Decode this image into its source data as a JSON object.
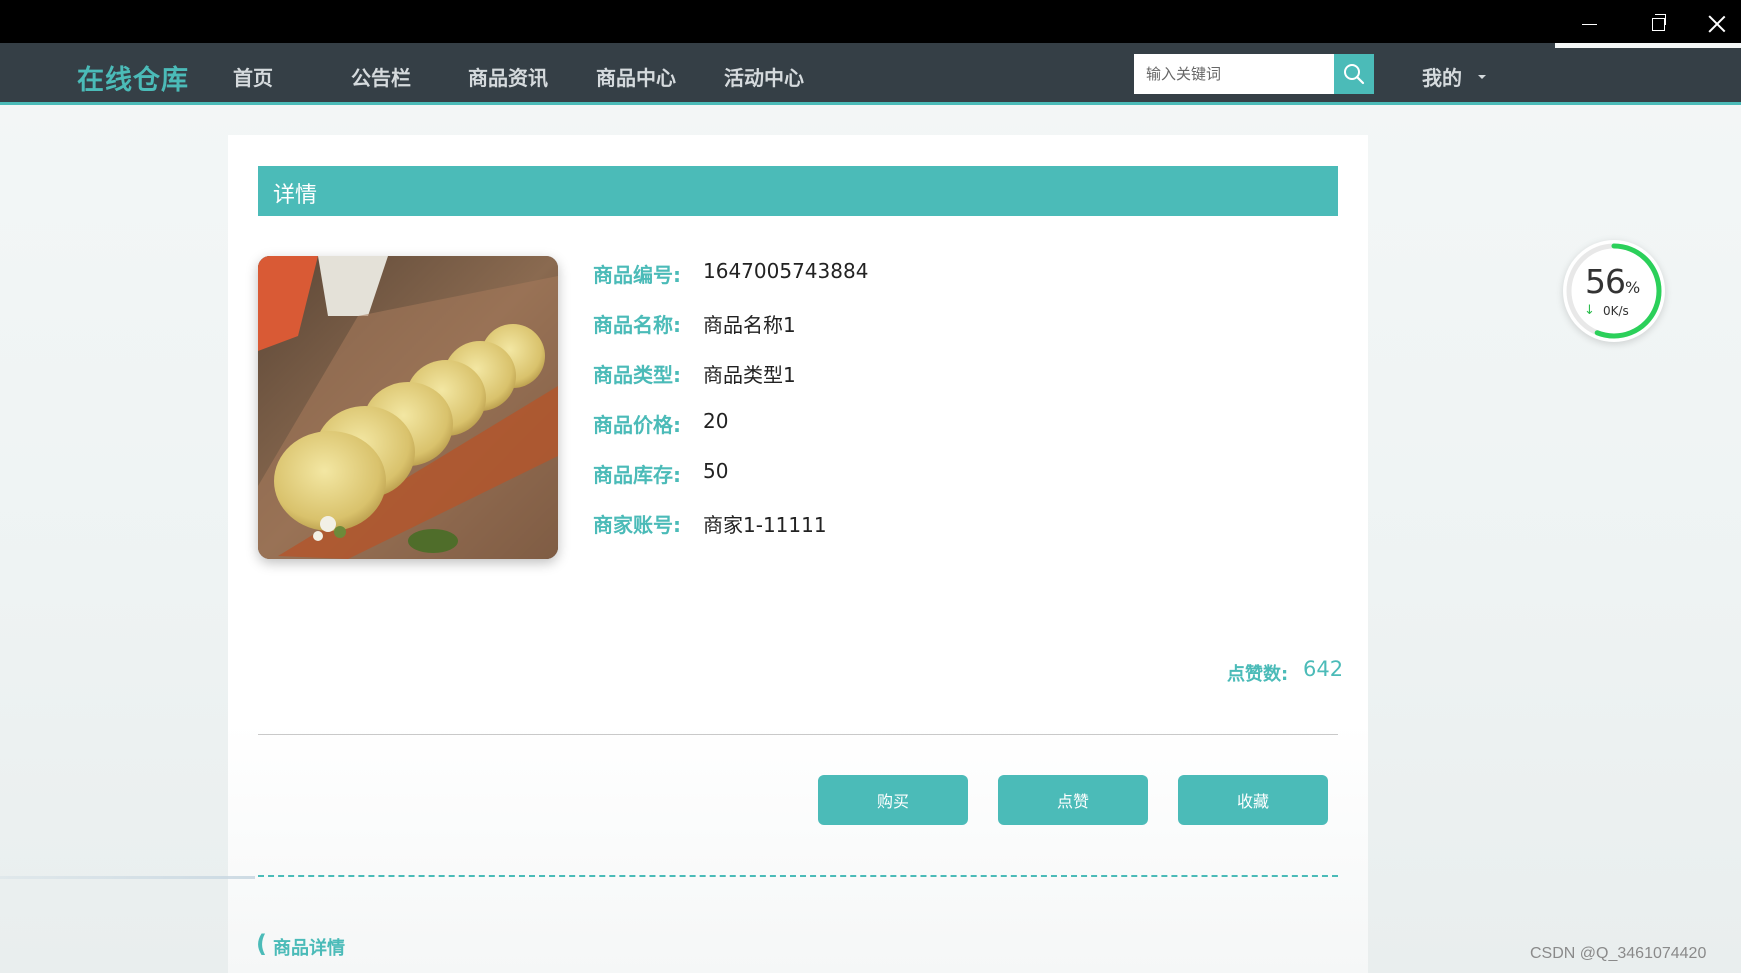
{
  "window": {
    "minimize_icon": "minimize-icon",
    "maximize_icon": "restore-icon",
    "close_icon": "close-icon"
  },
  "nav": {
    "brand": "在线仓库",
    "items": [
      "首页",
      "公告栏",
      "商品资讯",
      "商品中心",
      "活动中心"
    ],
    "search_placeholder": "输入关键词",
    "search_icon": "search-icon",
    "mine": "我的"
  },
  "detail": {
    "title": "详情",
    "fields": [
      {
        "label": "商品编号:",
        "value": "1647005743884"
      },
      {
        "label": "商品名称:",
        "value": "商品名称1"
      },
      {
        "label": "商品类型:",
        "value": "商品类型1"
      },
      {
        "label": "商品价格:",
        "value": "20"
      },
      {
        "label": "商品库存:",
        "value": "50"
      },
      {
        "label": "商家账号:",
        "value": "商家1-11111"
      }
    ],
    "likes_label": "点赞数:",
    "likes_value": "642",
    "buttons": {
      "buy": "购买",
      "like": "点赞",
      "favorite": "收藏"
    },
    "section_title": "商品详情"
  },
  "speed_widget": {
    "percent": "56",
    "percent_sign": "%",
    "rate": "0K/s",
    "progress": 0.56
  },
  "watermark": "CSDN @Q_3461074420",
  "colors": {
    "accent": "#4bbbb8",
    "nav_bg": "#353f46"
  }
}
